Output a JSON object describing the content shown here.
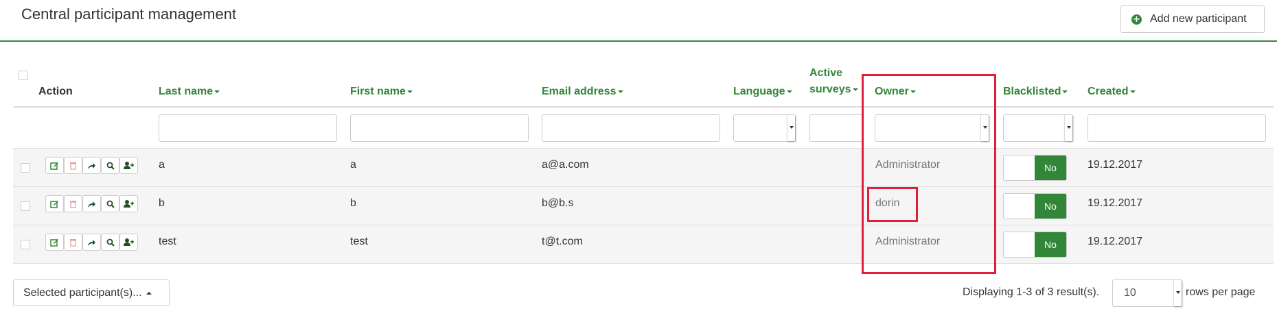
{
  "page": {
    "title": "Central participant management",
    "add_button": "Add new participant"
  },
  "columns": {
    "action": "Action",
    "last_name": "Last name",
    "first_name": "First name",
    "email": "Email address",
    "language": "Language",
    "active_surveys_line1": "Active",
    "active_surveys_line2": "surveys",
    "owner": "Owner",
    "blacklisted": "Blacklisted",
    "created": "Created"
  },
  "rows": [
    {
      "last_name": "a",
      "first_name": "a",
      "email": "a@a.com",
      "owner": "Administrator",
      "blacklisted": "No",
      "created": "19.12.2017"
    },
    {
      "last_name": "b",
      "first_name": "b",
      "email": "b@b.s",
      "owner": "dorin",
      "blacklisted": "No",
      "created": "19.12.2017"
    },
    {
      "last_name": "test",
      "first_name": "test",
      "email": "t@t.com",
      "owner": "Administrator",
      "blacklisted": "No",
      "created": "19.12.2017"
    }
  ],
  "footer": {
    "bulk_button": "Selected participant(s)...",
    "displaying": "Displaying 1-3 of 3 result(s).",
    "page_size": "10",
    "rows_per_page": "rows per page"
  },
  "colors": {
    "accent": "#328637",
    "highlight": "#e0203a",
    "delete_icon": "#e8a0a0"
  }
}
